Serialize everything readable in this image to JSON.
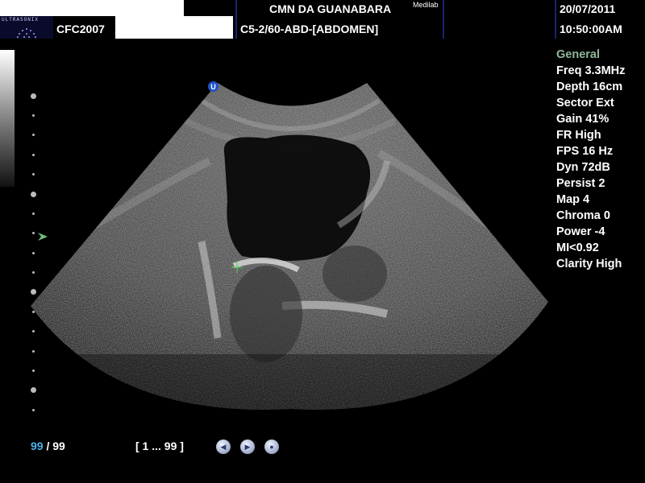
{
  "header": {
    "brand": "ULTRASONIX",
    "patient_id": "CFC2007",
    "facility": "CMN DA GUANABARA",
    "facility_sub": "Medilab",
    "preset": "C5-2/60-ABD-[ABDOMEN]",
    "date": "20/07/2011",
    "time": "10:50:00AM"
  },
  "params": {
    "section": "General",
    "items": [
      "Freq 3.3MHz",
      "Depth 16cm",
      "Sector Ext",
      "Gain 41%",
      "FR High",
      "FPS 16 Hz",
      "Dyn 72dB",
      "Persist 2",
      "Map 4",
      "Chroma 0",
      "Power -4",
      "MI<0.92",
      "Clarity High"
    ]
  },
  "image": {
    "orientation_marker": "U"
  },
  "footer": {
    "frame_current": "99",
    "frame_total": "/ 99",
    "frame_range": "[ 1 ... 99 ]"
  },
  "colors": {
    "background": "#000000",
    "frame_current": "#4fb3e8",
    "param_header": "#8fb89a",
    "focus_marker": "#6fbf7f",
    "caliper": "#4cd95a",
    "orientation_marker": "#1f53c9"
  },
  "icons": {
    "prev": "play-back-icon",
    "next": "play-forward-icon",
    "stop": "stop-icon"
  }
}
